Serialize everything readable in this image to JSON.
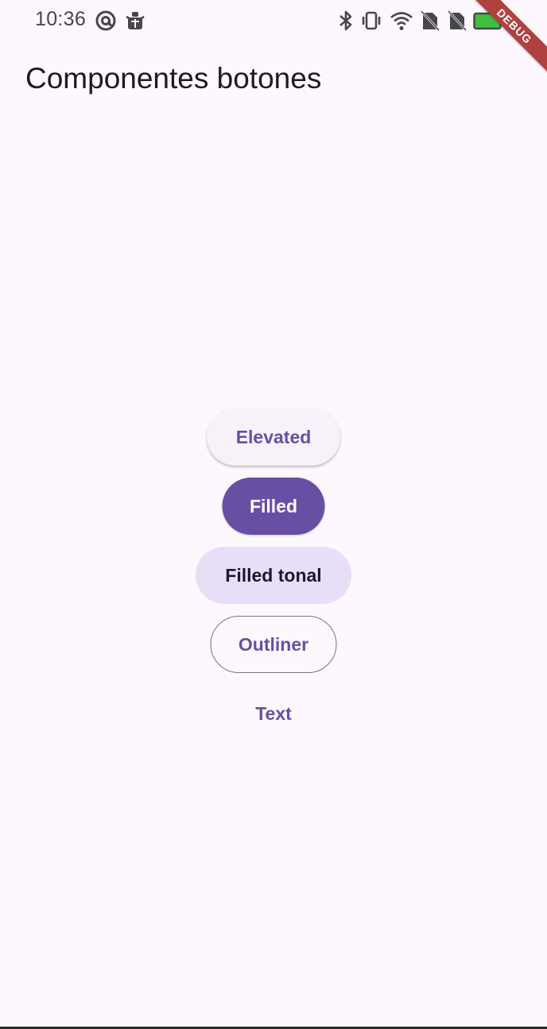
{
  "status_bar": {
    "time": "10:36",
    "left_icons": [
      "at-sign-icon",
      "android-debug-icon"
    ],
    "right_icons": [
      "bluetooth-icon",
      "vibrate-icon",
      "wifi-icon",
      "no-sim-icon",
      "no-sim-icon",
      "battery-icon"
    ]
  },
  "debug_banner": {
    "label": "DEBUG",
    "color": "#b0413e"
  },
  "app_bar": {
    "title": "Componentes botones"
  },
  "buttons": {
    "elevated": "Elevated",
    "filled": "Filled",
    "filled_tonal": "Filled tonal",
    "outlined": "Outliner",
    "text": "Text"
  },
  "colors": {
    "background": "#fdf8fd",
    "primary": "#6750a4",
    "tonal": "#e8def8",
    "outline": "#79747e",
    "battery": "#3fbf3f"
  }
}
